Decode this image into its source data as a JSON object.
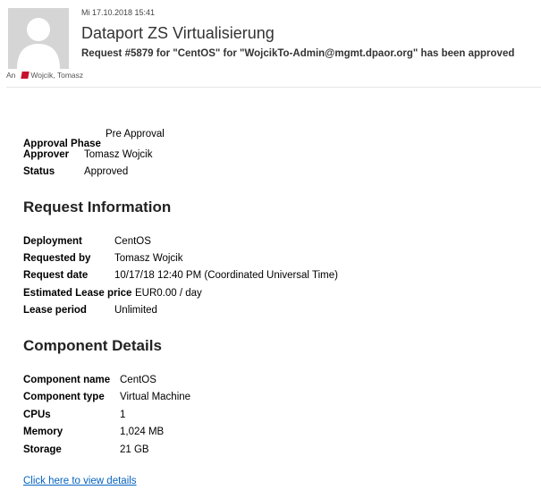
{
  "header": {
    "date": "Mi 17.10.2018 15:41",
    "sender": "Dataport ZS Virtualisierung",
    "subject": "Request #5879 for \"CentOS\" for \"WojcikTo-Admin@mgmt.dpaor.org\" has been approved",
    "to_label": "An",
    "recipient": "Wojcik, Tomasz"
  },
  "approval": [
    {
      "label": "Approval Phase",
      "value": "Pre Approval"
    },
    {
      "label": "Approver",
      "value": "Tomasz Wojcik"
    },
    {
      "label": "Status",
      "value": "Approved"
    }
  ],
  "request_information": {
    "heading": "Request Information",
    "rows": [
      {
        "label": "Deployment",
        "value": "CentOS"
      },
      {
        "label": "Requested by",
        "value": "Tomasz Wojcik"
      },
      {
        "label": "Request date",
        "value": "10/17/18 12:40 PM (Coordinated Universal Time)"
      },
      {
        "label": "Estimated Lease price",
        "value": "EUR0.00 / day"
      },
      {
        "label": "Lease period",
        "value": "Unlimited"
      }
    ]
  },
  "component_details": {
    "heading": "Component Details",
    "rows": [
      {
        "label": "Component name",
        "value": "CentOS"
      },
      {
        "label": "Component type",
        "value": "Virtual Machine"
      },
      {
        "label": "CPUs",
        "value": "1"
      },
      {
        "label": "Memory",
        "value": "1,024 MB"
      },
      {
        "label": "Storage",
        "value": "21 GB"
      }
    ]
  },
  "footer": {
    "link_text": "Click here to view details"
  }
}
